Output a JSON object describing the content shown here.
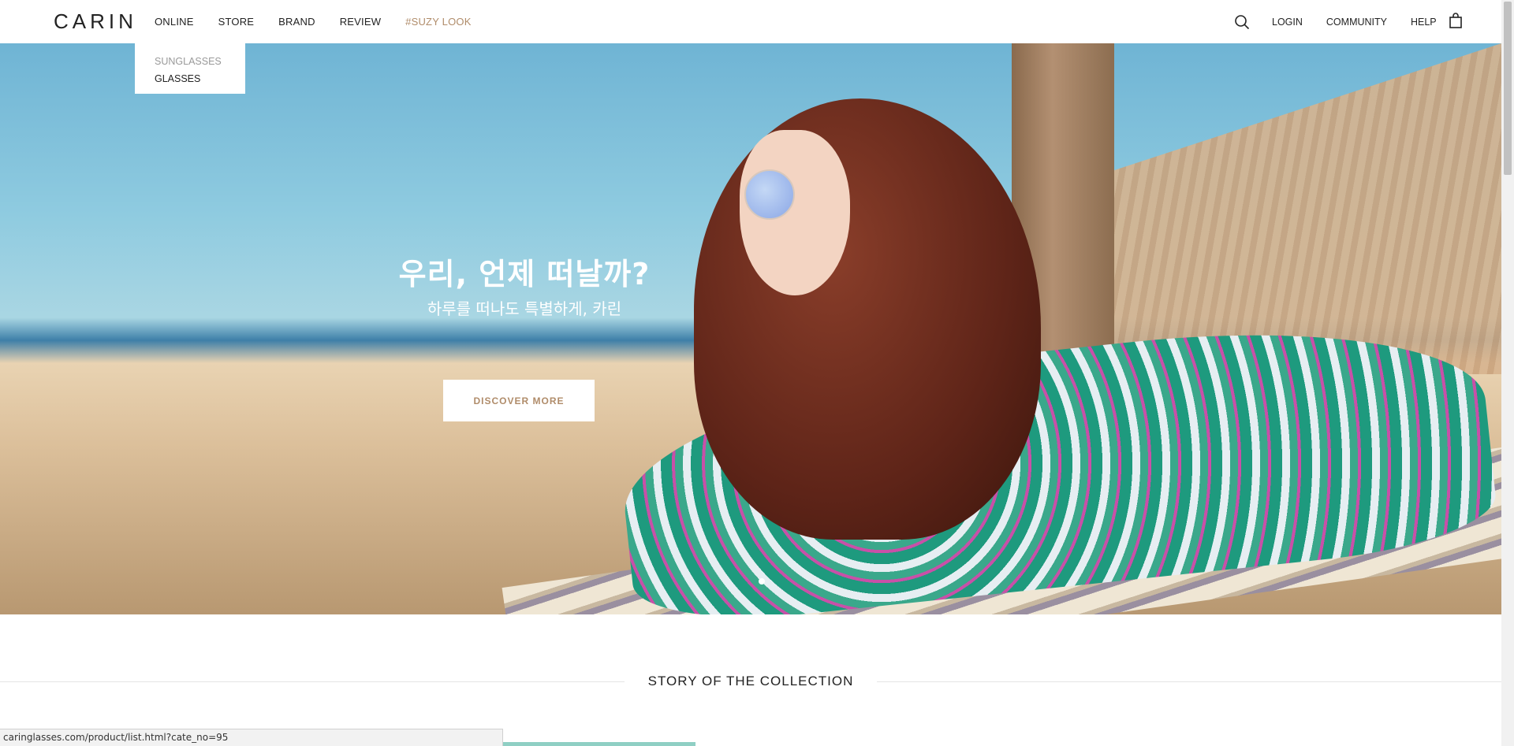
{
  "header": {
    "logo": "CARIN",
    "nav_left": [
      "ONLINE",
      "STORE",
      "BRAND",
      "REVIEW",
      "#SUZY LOOK"
    ],
    "nav_right": [
      "LOGIN",
      "COMMUNITY",
      "HELP"
    ],
    "icons": {
      "search": "search-icon",
      "bag": "shopping-bag-icon"
    }
  },
  "dropdown": {
    "items": [
      "SUNGLASSES",
      "GLASSES"
    ]
  },
  "hero": {
    "title": "우리, 언제 떠날까?",
    "subtitle": "하루를 떠나도 특별하게, 카린",
    "button_label": "DISCOVER MORE"
  },
  "section": {
    "title": "STORY OF THE COLLECTION"
  },
  "status_bar": {
    "url": "caringlasses.com/product/list.html?cate_no=95"
  },
  "colors": {
    "accent": "#b08c6a",
    "text": "#222222"
  }
}
